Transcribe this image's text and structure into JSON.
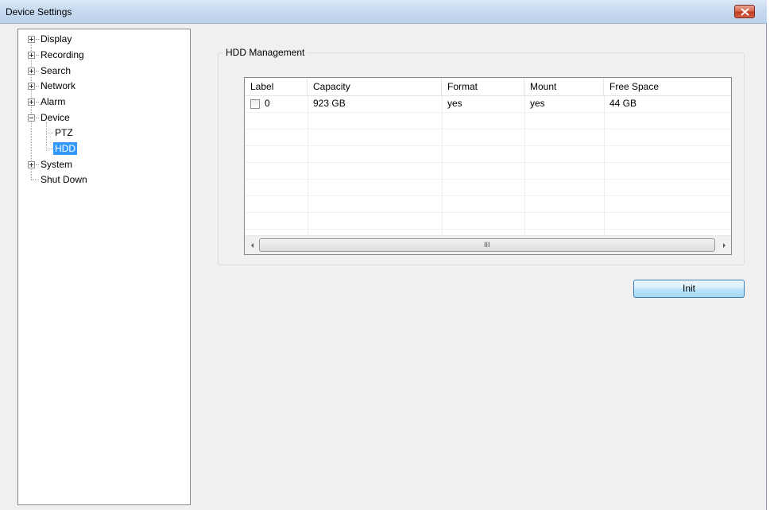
{
  "window": {
    "title": "Device Settings"
  },
  "tree": {
    "items": [
      {
        "label": "Display"
      },
      {
        "label": "Recording"
      },
      {
        "label": "Search"
      },
      {
        "label": "Network"
      },
      {
        "label": "Alarm"
      },
      {
        "label": "Device"
      },
      {
        "label": "PTZ"
      },
      {
        "label": "HDD"
      },
      {
        "label": "System"
      },
      {
        "label": "Shut Down"
      }
    ]
  },
  "hdd": {
    "group_title": "HDD Management",
    "columns": [
      "Label",
      "Capacity",
      "Format",
      "Mount",
      "Free Space"
    ],
    "rows": [
      {
        "label": "0",
        "capacity": "923 GB",
        "format": "yes",
        "mount": "yes",
        "free_space": "44 GB",
        "checked": false
      }
    ],
    "scroll_grip": "III",
    "init_label": "Init"
  },
  "colors": {
    "selection": "#3399ff",
    "title_bar": "#c6d9ef",
    "close_button": "#c43a1e"
  },
  "icons": [
    "close-icon",
    "expand-icon",
    "collapse-icon",
    "scroll-left-icon",
    "scroll-right-icon",
    "checkbox-icon"
  ]
}
